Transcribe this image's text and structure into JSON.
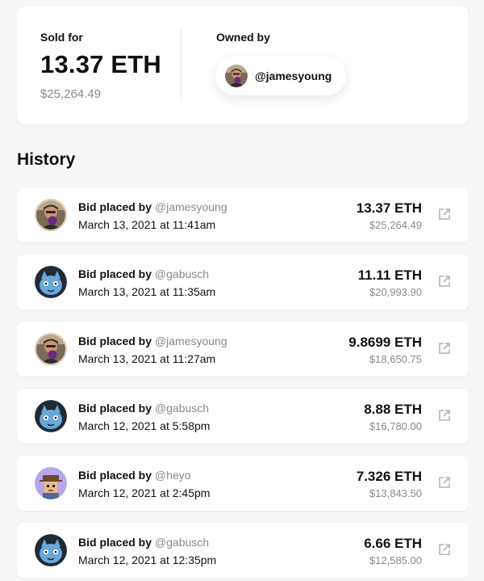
{
  "summary": {
    "sold_label": "Sold for",
    "sold_eth": "13.37 ETH",
    "sold_usd": "$25,264.49",
    "owned_label": "Owned by",
    "owner": "@jamesyoung"
  },
  "history_title": "History",
  "history": [
    {
      "action": "Bid placed by",
      "handle": "@jamesyoung",
      "date": "March 13, 2021 at 11:41am",
      "eth": "13.37 ETH",
      "usd": "$25,264.49",
      "avatar": "jamesyoung-avatar"
    },
    {
      "action": "Bid placed by",
      "handle": "@gabusch",
      "date": "March 13, 2021 at 11:35am",
      "eth": "11.11 ETH",
      "usd": "$20,993.90",
      "avatar": "gabusch-avatar"
    },
    {
      "action": "Bid placed by",
      "handle": "@jamesyoung",
      "date": "March 13, 2021 at 11:27am",
      "eth": "9.8699 ETH",
      "usd": "$18,650.75",
      "avatar": "jamesyoung-avatar"
    },
    {
      "action": "Bid placed by",
      "handle": "@gabusch",
      "date": "March 12, 2021 at 5:58pm",
      "eth": "8.88 ETH",
      "usd": "$16,780.00",
      "avatar": "gabusch-avatar"
    },
    {
      "action": "Bid placed by",
      "handle": "@heyo",
      "date": "March 12, 2021 at 2:45pm",
      "eth": "7.326 ETH",
      "usd": "$13,843.50",
      "avatar": "heyo-avatar"
    },
    {
      "action": "Bid placed by",
      "handle": "@gabusch",
      "date": "March 12, 2021 at 12:35pm",
      "eth": "6.66 ETH",
      "usd": "$12,585.00",
      "avatar": "gabusch-avatar"
    }
  ],
  "icons": {
    "external_link": "external-link-icon"
  },
  "colors": {
    "muted_text": "#8a8a8a",
    "primary_text": "#111111",
    "background": "#f7f7f7",
    "card": "#ffffff"
  }
}
